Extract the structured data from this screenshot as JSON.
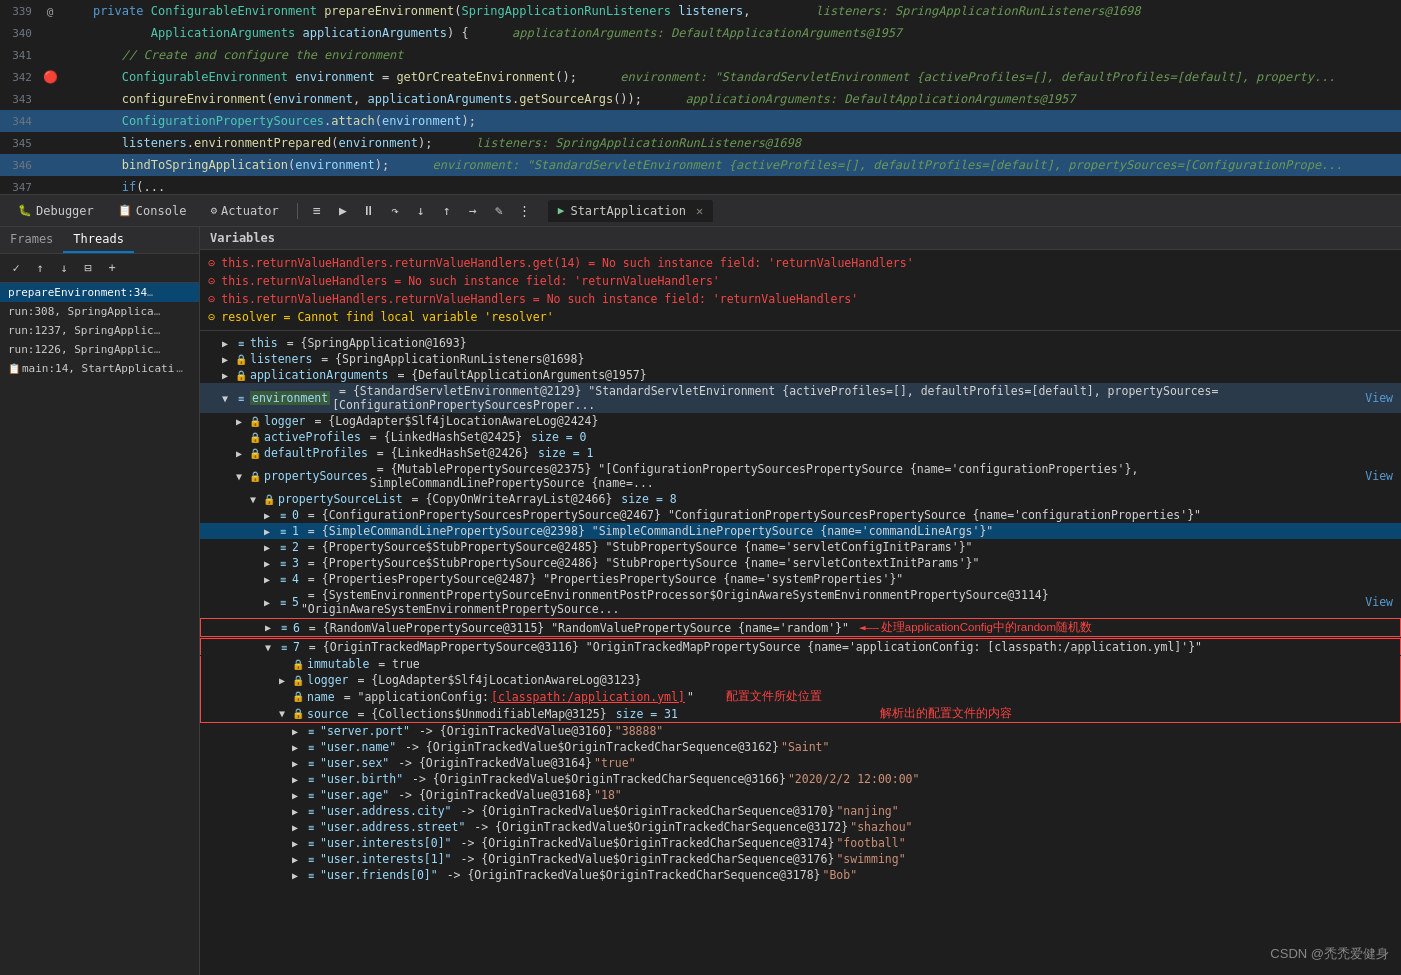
{
  "debug": {
    "tabs": {
      "debugger": "Debugger",
      "console": "Console",
      "actuator": "Actuator",
      "variables": "Variables"
    },
    "app_name": "StartApplication",
    "panel_tabs": {
      "frames": "Frames",
      "threads": "Threads"
    }
  },
  "code_lines": [
    {
      "num": "339",
      "icon": "@",
      "content": "    private ConfigurableEnvironment prepareEnvironment(SpringApplicationRunListeners listeners,",
      "comment": "    listeners: SpringApplicationRunListeners@1698"
    },
    {
      "num": "340",
      "icon": "",
      "content": "            ApplicationArguments applicationArguments) {",
      "comment": "    applicationArguments: DefaultApplicationArguments@1957"
    },
    {
      "num": "341",
      "icon": "",
      "content": "        // Create and configure the environment",
      "comment": ""
    },
    {
      "num": "342",
      "icon": "🔴",
      "content": "        ConfigurableEnvironment environment = getOrCreateEnvironment();",
      "comment": "    environment: \"StandardServletEnvironment {activeProfiles=[], defaultProfiles=[default], property..."
    },
    {
      "num": "343",
      "icon": "",
      "content": "        configureEnvironment(environment, applicationArguments.getSourceArgs());",
      "comment": "    applicationArguments: DefaultApplicationArguments@1957"
    },
    {
      "num": "344",
      "icon": "",
      "content": "        ConfigurationPropertySources.attach(environment);",
      "comment": ""
    },
    {
      "num": "345",
      "icon": "",
      "content": "        listeners.environmentPrepared(environment);",
      "comment": "    listeners: SpringApplicationRunListeners@1698"
    },
    {
      "num": "346",
      "icon": "",
      "content": "        bindToSpringApplication(environment);",
      "comment": "    environment: \"StandardServletEnvironment {activeProfiles=[], defaultProfiles=[default], propertySources=[ConfigurationPrope..."
    },
    {
      "num": "347",
      "icon": "",
      "content": "        if(/**",
      "comment": ""
    }
  ],
  "frames": [
    {
      "label": "prepareEnvironment:34",
      "sub": ""
    },
    {
      "label": "run:308, SpringApplica",
      "sub": ""
    },
    {
      "label": "run:1237, SpringApplic",
      "sub": ""
    },
    {
      "label": "run:1226, SpringApplic",
      "sub": ""
    },
    {
      "label": "main:14, StartApplicati",
      "sub": ""
    }
  ],
  "error_items": [
    "this.returnValueHandlers.returnValueHandlers.get(14) = No such instance field: 'returnValueHandlers'",
    "this.returnValueHandlers = No such instance field: 'returnValueHandlers'",
    "this.returnValueHandlers.returnValueHandlers = No such instance field: 'returnValueHandlers'",
    "resolver = Cannot find local variable 'resolver'"
  ],
  "variables": [
    {
      "indent": 0,
      "expanded": false,
      "icon": "≡",
      "name": "this",
      "val": "= {SpringApplication@1693}"
    },
    {
      "indent": 0,
      "expanded": false,
      "icon": "≡",
      "name": "listeners",
      "val": "= {SpringApplicationRunListeners@1698}"
    },
    {
      "indent": 0,
      "expanded": false,
      "icon": "≡",
      "name": "applicationArguments",
      "val": "= {DefaultApplicationArguments@1957}"
    },
    {
      "indent": 0,
      "expanded": true,
      "icon": "≡",
      "name": "environment",
      "val": "= {StandardServletEnvironment@2129} \"StandardServletEnvironment {activeProfiles=[], defaultProfiles=[default], propertySources=[ConfigurationPropertySourcesProper...\"",
      "view": "View"
    },
    {
      "indent": 1,
      "expanded": false,
      "icon": "🔒",
      "name": "logger",
      "val": "= {LogAdapter$Slf4jLocationAwareLog@2424}"
    },
    {
      "indent": 1,
      "expanded": false,
      "icon": "🔒",
      "name": "activeProfiles",
      "val": "= {LinkedHashSet@2425}  size = 0"
    },
    {
      "indent": 1,
      "expanded": false,
      "icon": "🔒",
      "name": "defaultProfiles",
      "val": "= {LinkedHashSet@2426}  size = 1"
    },
    {
      "indent": 1,
      "expanded": true,
      "icon": "🔒",
      "name": "propertySources",
      "val": "= {MutablePropertySources@2375} \"[ConfigurationPropertySourcesPropertySource {name='configurationProperties'}, SimpleCommandLinePropertySource {name=...\"",
      "view": "View"
    },
    {
      "indent": 2,
      "expanded": true,
      "icon": "🔒",
      "name": "propertySourceList",
      "val": "= {CopyOnWriteArrayList@2466}  size = 8"
    },
    {
      "indent": 3,
      "expanded": false,
      "icon": "≡",
      "name": "0",
      "val": "= {ConfigurationPropertySourcesPropertySource@2467} \"ConfigurationPropertySourcesPropertySource {name='configurationProperties'}\""
    },
    {
      "indent": 3,
      "expanded": false,
      "icon": "≡",
      "name": "1",
      "val": "= {SimpleCommandLinePropertySource@2398} \"SimpleCommandLinePropertySource {name='commandLineArgs'}\"",
      "selected": true
    },
    {
      "indent": 3,
      "expanded": false,
      "icon": "≡",
      "name": "2",
      "val": "= {PropertySource$StubPropertySource@2485} \"StubPropertySource {name='servletConfigInitParams'}\""
    },
    {
      "indent": 3,
      "expanded": false,
      "icon": "≡",
      "name": "3",
      "val": "= {PropertySource$StubPropertySource@2486} \"StubPropertySource {name='servletContextInitParams'}\""
    },
    {
      "indent": 3,
      "expanded": false,
      "icon": "≡",
      "name": "4",
      "val": "= {PropertiesPropertySource@2487} \"PropertiesPropertySource {name='systemProperties'}\""
    },
    {
      "indent": 3,
      "expanded": false,
      "icon": "≡",
      "name": "5",
      "val": "= {SystemEnvironmentPropertySourceEnvironmentPostProcessor$OriginAwareSystemEnvironmentPropertySource@3114} \"OriginAwareSystemEnvironmentPropertySource...\"",
      "view": "View"
    },
    {
      "indent": 3,
      "expanded": false,
      "icon": "≡",
      "name": "6",
      "val": "= {RandomValuePropertySource@3115} \"RandomValuePropertySource {name='random'}\"",
      "annotation": "处理applicationConfig中的random随机数",
      "border": true
    },
    {
      "indent": 3,
      "expanded": true,
      "icon": "≡",
      "name": "7",
      "val": "= {OriginTrackedMapPropertySource@3116} \"OriginTrackedMapPropertySource {name='applicationConfig: [classpath:/application.yml]'}\""
    },
    {
      "indent": 4,
      "expanded": false,
      "icon": "🔒",
      "name": "immutable",
      "val": "= true"
    },
    {
      "indent": 4,
      "expanded": false,
      "icon": "🔒",
      "name": "logger",
      "val": "= {LogAdapter$Slf4jLocationAwareLog@3123}"
    },
    {
      "indent": 4,
      "expanded": false,
      "icon": "🔒",
      "name": "name",
      "val": "= \"applicationConfig: [classpath:/application.yml]\"",
      "annotation2": "配置文件所处位置"
    },
    {
      "indent": 4,
      "expanded": true,
      "icon": "🔒",
      "name": "source",
      "val": "= {Collections$UnmodifiableMap@3125}  size = 31"
    },
    {
      "indent": 5,
      "expanded": false,
      "icon": "≡",
      "name": "\"server.port\"",
      "val": "-> {OriginTrackedValue@3160} \"38888\""
    },
    {
      "indent": 5,
      "expanded": false,
      "icon": "≡",
      "name": "\"user.name\"",
      "val": "-> {OriginTrackedValue$OriginTrackedCharSequence@3162} \"Saint\""
    },
    {
      "indent": 5,
      "expanded": false,
      "icon": "≡",
      "name": "\"user.sex\"",
      "val": "-> {OriginTrackedValue@3164} \"true\""
    },
    {
      "indent": 5,
      "expanded": false,
      "icon": "≡",
      "name": "\"user.birth\"",
      "val": "-> {OriginTrackedValue$OriginTrackedCharSequence@3166} \"2020/2/2 12:00:00\""
    },
    {
      "indent": 5,
      "expanded": false,
      "icon": "≡",
      "name": "\"user.age\"",
      "val": "-> {OriginTrackedValue@3168} \"18\""
    },
    {
      "indent": 5,
      "expanded": false,
      "icon": "≡",
      "name": "\"user.address.city\"",
      "val": "-> {OriginTrackedValue$OriginTrackedCharSequence@3170} \"nanjing\""
    },
    {
      "indent": 5,
      "expanded": false,
      "icon": "≡",
      "name": "\"user.address.street\"",
      "val": "-> {OriginTrackedValue$OriginTrackedCharSequence@3172} \"shazhou\""
    },
    {
      "indent": 5,
      "expanded": false,
      "icon": "≡",
      "name": "\"user.interests[0]\"",
      "val": "-> {OriginTrackedValue$OriginTrackedCharSequence@3174} \"football\""
    },
    {
      "indent": 5,
      "expanded": false,
      "icon": "≡",
      "name": "\"user.interests[1]\"",
      "val": "-> {OriginTrackedValue$OriginTrackedCharSequence@3176} \"swimming\""
    },
    {
      "indent": 5,
      "expanded": false,
      "icon": "≡",
      "name": "\"user.friends[0]\"",
      "val": "-> {OriginTrackedValue$OriginTrackedCharSequence@3178} \"Bob\""
    }
  ],
  "watermark": "CSDN @禿禿爱健身",
  "toolbar": {
    "resume": "▶",
    "stepover": "↷",
    "stepinto": "↓",
    "stepout": "↑",
    "runtocursor": "→",
    "evaluate": "✎",
    "frames_label": "Frames",
    "threads_label": "Threads",
    "variables_label": "Variables"
  }
}
